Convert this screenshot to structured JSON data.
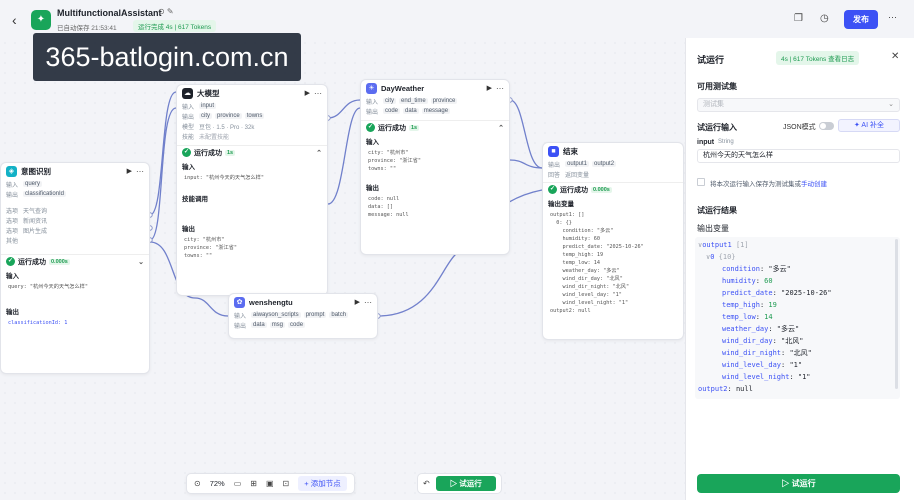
{
  "header": {
    "title": "MultifunctionalAssistant",
    "title_icons": "⊙ ✎",
    "autosave": "已自动保存 21:53:41",
    "run_status": "运行完成 4s | 617 Tokens",
    "publish": "发布",
    "icons": {
      "copy": "❐",
      "history": "◷",
      "more": "⋯",
      "back": "‹",
      "app": "✦"
    }
  },
  "watermark": "365-batlogin.com.cn",
  "nodes": {
    "intent": {
      "title": "意图识别",
      "inputs": [
        {
          "k": "输入",
          "v": "query"
        },
        {
          "k": "输出",
          "v": "classificationId"
        }
      ],
      "options": [
        {
          "k": "选项",
          "v": "天气查询"
        },
        {
          "k": "选项",
          "v": "新闻资讯"
        },
        {
          "k": "选项",
          "v": "图片生成"
        },
        {
          "k": "其他",
          "v": ""
        }
      ],
      "success": "运行成功",
      "time": "0.000s",
      "in_label": "输入",
      "in_code": "query: \"杭州今天的天气怎么样\"",
      "out_label": "输出",
      "out_code": "classificationId: 1"
    },
    "llm": {
      "title": "大模型",
      "r1k": "输入",
      "r1": "input",
      "r2k": "输出",
      "r2a": "city",
      "r2b": "province",
      "r2c": "towns",
      "r3k": "模型",
      "r3": "豆包 · 1.5 · Pro · 32k",
      "r4k": "技能",
      "r4": "未配置技能",
      "success": "运行成功",
      "time": "1s",
      "in_label": "输入",
      "in_code": "input: \"杭州今天的天气怎么样\"",
      "skill_label": "技能调用",
      "out_label": "输出",
      "out_code": "city: \"杭州市\"\nprovince: \"浙江省\"\ntowns: \"\""
    },
    "weather": {
      "title": "DayWeather",
      "r1k": "输入",
      "r1a": "city",
      "r1b": "end_time",
      "r1c": "province",
      "r2k": "输出",
      "r2a": "code",
      "r2b": "data",
      "r2c": "message",
      "success": "运行成功",
      "time": "1s",
      "in_label": "输入",
      "in_code": "city: \"杭州市\"\nprovince: \"浙江省\"\ntowns: \"\"",
      "out_label": "输出",
      "out_code": "code: null\ndata: []\nmessage: null"
    },
    "end": {
      "title": "结束",
      "r1k": "输出",
      "r1a": "output1",
      "r1b": "output2",
      "r2k": "回答",
      "r2": "返回变量",
      "success": "运行成功",
      "time": "0.000s",
      "out_label": "输出变量",
      "out_code": "output1: []\n  0: {}\n    condition: \"多云\"\n    humidity: 60\n    predict_date: \"2025-10-26\"\n    temp_high: 19\n    temp_low: 14\n    weather_day: \"多云\"\n    wind_dir_day: \"北风\"\n    wind_dir_night: \"北风\"\n    wind_level_day: \"1\"\n    wind_level_night: \"1\"\noutput2: null"
    },
    "wensheng": {
      "title": "wenshengtu",
      "r1k": "输入",
      "r1a": "aiwayson_scripts",
      "r1b": "prompt",
      "r1c": "batch",
      "r2k": "输出",
      "r2a": "data",
      "r2b": "msg",
      "r2c": "code"
    }
  },
  "panel": {
    "title": "试运行",
    "badge": "4s | 617 Tokens  查看日志",
    "close": "✕",
    "testset_label": "可用测试集",
    "testset_placeholder": "测试集",
    "run_input_label": "试运行输入",
    "json_mode": "JSON模式",
    "ai_fill": "✦ AI 补全",
    "input_name": "input",
    "input_type": "String",
    "input_value": "杭州今天的天气怎么样",
    "save_text": "将本次运行输入保存为测试集或",
    "save_link": "手动创建",
    "result_label": "试运行结果",
    "output_vars_label": "输出变量",
    "result_lines": [
      {
        "k": "output1",
        "m": "[1]",
        "ind": 0,
        "arrow": "∨"
      },
      {
        "k": "0",
        "m": "{10}",
        "ind": 1,
        "arrow": "∨"
      },
      {
        "k": "condition",
        "v": "\"多云\"",
        "ind": 3
      },
      {
        "k": "humidity",
        "v": "60",
        "ind": 3,
        "num": true
      },
      {
        "k": "predict_date",
        "v": "\"2025-10-26\"",
        "ind": 3
      },
      {
        "k": "temp_high",
        "v": "19",
        "ind": 3,
        "num": true
      },
      {
        "k": "temp_low",
        "v": "14",
        "ind": 3,
        "num": true
      },
      {
        "k": "weather_day",
        "v": "\"多云\"",
        "ind": 3
      },
      {
        "k": "wind_dir_day",
        "v": "\"北风\"",
        "ind": 3
      },
      {
        "k": "wind_dir_night",
        "v": "\"北风\"",
        "ind": 3
      },
      {
        "k": "wind_level_day",
        "v": "\"1\"",
        "ind": 3
      },
      {
        "k": "wind_level_night",
        "v": "\"1\"",
        "ind": 3
      },
      {
        "k": "output2",
        "v": "null",
        "ind": 0
      }
    ],
    "run_button": "▷ 试运行"
  },
  "toolbar": {
    "zoom": "72%",
    "add_node": "+ 添加节点",
    "run": "▷ 试运行",
    "icons": [
      "⊙",
      "▭",
      "⊞",
      "▣",
      "⊡",
      "↶"
    ]
  }
}
